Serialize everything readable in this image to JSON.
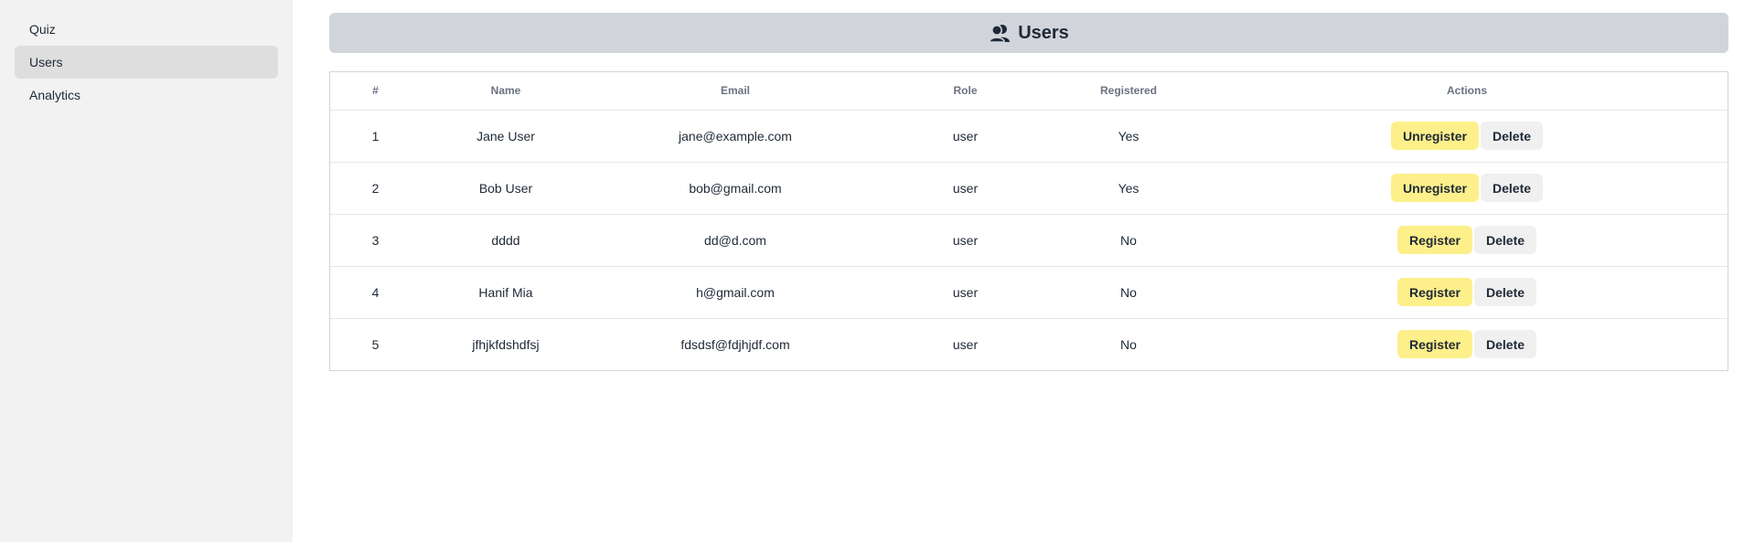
{
  "sidebar": {
    "items": [
      {
        "label": "Quiz",
        "active": false
      },
      {
        "label": "Users",
        "active": true
      },
      {
        "label": "Analytics",
        "active": false
      }
    ]
  },
  "header": {
    "title": "Users",
    "icon": "users-icon"
  },
  "table": {
    "columns": [
      "#",
      "Name",
      "Email",
      "Role",
      "Registered",
      "Actions"
    ],
    "rows": [
      {
        "index": "1",
        "name": "Jane User",
        "email": "jane@example.com",
        "role": "user",
        "registered": "Yes",
        "toggle_label": "Unregister",
        "delete_label": "Delete"
      },
      {
        "index": "2",
        "name": "Bob User",
        "email": "bob@gmail.com",
        "role": "user",
        "registered": "Yes",
        "toggle_label": "Unregister",
        "delete_label": "Delete"
      },
      {
        "index": "3",
        "name": "dddd",
        "email": "dd@d.com",
        "role": "user",
        "registered": "No",
        "toggle_label": "Register",
        "delete_label": "Delete"
      },
      {
        "index": "4",
        "name": "Hanif Mia",
        "email": "h@gmail.com",
        "role": "user",
        "registered": "No",
        "toggle_label": "Register",
        "delete_label": "Delete"
      },
      {
        "index": "5",
        "name": "jfhjkfdshdfsj",
        "email": "fdsdsf@fdjhjdf.com",
        "role": "user",
        "registered": "No",
        "toggle_label": "Register",
        "delete_label": "Delete"
      }
    ]
  },
  "colors": {
    "sidebar_bg": "#f2f2f2",
    "active_nav_bg": "#dedede",
    "header_bg": "#d1d5db",
    "register_button_bg": "#fdf08a",
    "delete_button_bg": "#f0f0f0"
  }
}
